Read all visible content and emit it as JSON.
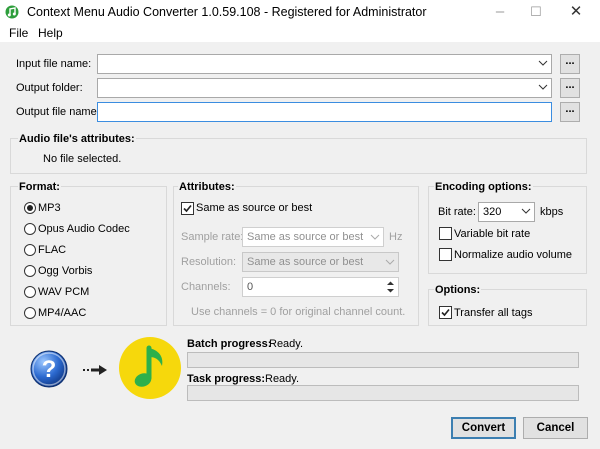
{
  "window": {
    "title": "Context Menu Audio Converter 1.0.59.108 - Registered for Administrator",
    "controls": [
      "–",
      "☐",
      "✕"
    ]
  },
  "menu": [
    "File",
    "Help"
  ],
  "io": {
    "input_label": "Input file name:",
    "input_value": "",
    "output_folder_label": "Output folder:",
    "output_folder_value": "",
    "output_name_label": "Output file name:",
    "output_name_value": "",
    "browse_label": "..."
  },
  "attributes_info": {
    "title": "Audio file's attributes:",
    "status": "No file selected."
  },
  "format": {
    "title": "Format:",
    "options": [
      "MP3",
      "Opus Audio Codec",
      "FLAC",
      "Ogg Vorbis",
      "WAV PCM",
      "MP4/AAC"
    ],
    "selected": "MP3"
  },
  "attributes": {
    "title": "Attributes:",
    "same_as_source_label": "Same as source or best",
    "same_as_source_checked": true,
    "sample_rate_label": "Sample rate:",
    "sample_rate_value": "Same as source or best",
    "sample_rate_unit": "Hz",
    "resolution_label": "Resolution:",
    "resolution_value": "Same as source or best",
    "channels_label": "Channels:",
    "channels_value": "0",
    "hint": "Use channels = 0 for original channel count."
  },
  "encoding": {
    "title": "Encoding options:",
    "bitrate_label": "Bit rate:",
    "bitrate_value": "320",
    "bitrate_unit": "kbps",
    "variable_label": "Variable bit rate",
    "variable_checked": false,
    "normalize_label": "Normalize audio volume",
    "normalize_checked": false
  },
  "options": {
    "title": "Options:",
    "transfer_label": "Transfer all tags",
    "transfer_checked": true
  },
  "progress": {
    "batch_label": "Batch progress:",
    "batch_status": "Ready.",
    "batch_fraction": 0,
    "task_label": "Task progress:",
    "task_status": "Ready.",
    "task_fraction": 0
  },
  "buttons": {
    "convert": "Convert",
    "cancel": "Cancel"
  },
  "icons": {
    "app": "audio-converter-icon",
    "help": "question-mark-icon",
    "arrow": "arrow-right-icon",
    "music": "music-note-icon"
  },
  "colors": {
    "help_blue": "#1f5fbf",
    "music_yellow": "#f6d80c",
    "music_green": "#2db04b",
    "focus_blue": "#3b8de0"
  }
}
